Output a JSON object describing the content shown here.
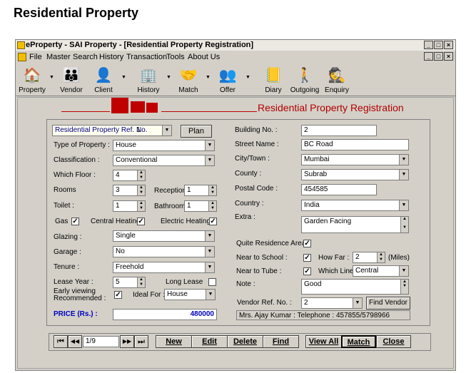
{
  "page_title": "Residential Property",
  "window": {
    "title": "eProperty - SAI Property - [Residential Property Registration]",
    "controls": [
      "_",
      "□",
      "×"
    ]
  },
  "menu": [
    "File",
    "Master",
    "Search",
    "History",
    "Transaction",
    "Tools",
    "About Us"
  ],
  "toolbar": [
    "Property",
    "Vendor",
    "Client",
    "History",
    "Match",
    "Offer",
    "Diary",
    "Outgoing",
    "Enquiry"
  ],
  "form_heading": "Residential Property Registration",
  "left": {
    "ref_label": "Residential Property Ref. No.",
    "ref_value": "1",
    "plan_button": "Plan",
    "type_label": "Type of Property :",
    "type_value": "House",
    "class_label": "Classification :",
    "class_value": "Conventional",
    "floor_label": "Which Floor :",
    "floor_value": "4",
    "rooms_label": "Rooms",
    "rooms_value": "3",
    "reception_label": "Reception",
    "reception_value": "1",
    "toilet_label": "Toilet :",
    "toilet_value": "1",
    "bathroom_label": "Bathroom :",
    "bathroom_value": "1",
    "gas_label": "Gas",
    "central_label": "Central Heating",
    "electric_label": "Electric Heating",
    "glazing_label": "Glazing :",
    "glazing_value": "Single",
    "garage_label": "Garage :",
    "garage_value": "No",
    "tenure_label": "Tenure :",
    "tenure_value": "Freehold",
    "lease_label": "Lease Year :",
    "lease_value": "5",
    "longlease_label": "Long Lease",
    "early_label_1": "Early viewing",
    "early_label_2": "Recommended :",
    "ideal_label": "Ideal For :",
    "ideal_value": "House",
    "price_label": "PRICE  (Rs.) :",
    "price_value": "480000",
    "check_mark": "✓"
  },
  "right": {
    "building_label": "Building No. :",
    "building_value": "2",
    "street_label": "Street Name :",
    "street_value": "BC Road",
    "city_label": "City/Town :",
    "city_value": "Mumbai",
    "county_label": "County :",
    "county_value": "Subrab",
    "postal_label": "Postal Code :",
    "postal_value": "454585",
    "country_label": "Country :",
    "country_value": "India",
    "extra_label": "Extra :",
    "extra_value": "Garden Facing",
    "quite_label": "Quite Residence Area",
    "school_label": "Near to School :",
    "howfar_label": "How Far :",
    "howfar_value": "2",
    "miles_label": "(Miles)",
    "tube_label": "Near to Tube :",
    "whichline_label": "Which Line :",
    "whichline_value": "Central",
    "note_label": "Note :",
    "note_value": "Good",
    "vendor_label": "Vendor Ref. No. :",
    "vendor_value": "2",
    "find_vendor_button": "Find Vendor",
    "vendor_info": "Mrs. Ajay Kumar  : Telephone : 457855/5798966"
  },
  "nav": {
    "record": "1/9",
    "first": "⏮",
    "prev": "◀◀",
    "next": "▶▶",
    "last": "⏭",
    "buttons": [
      "New",
      "Edit",
      "Delete",
      "Find",
      "View All",
      "Match",
      "Close"
    ]
  }
}
